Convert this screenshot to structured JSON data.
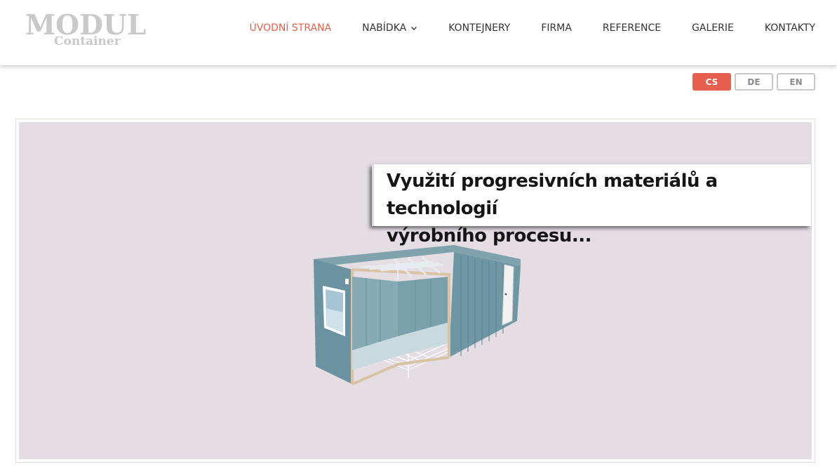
{
  "logo": {
    "line1": "MODUL",
    "line2": "Container"
  },
  "nav": {
    "items": [
      {
        "label": "ÚVODNÍ STRANA",
        "active": true
      },
      {
        "label": "NABÍDKA",
        "dropdown": true
      },
      {
        "label": "KONTEJNERY"
      },
      {
        "label": "FIRMA"
      },
      {
        "label": "REFERENCE"
      },
      {
        "label": "GALERIE"
      },
      {
        "label": "KONTAKTY"
      }
    ]
  },
  "languages": [
    {
      "label": "CS",
      "active": true
    },
    {
      "label": "DE"
    },
    {
      "label": "EN"
    }
  ],
  "slider": {
    "caption": "Využití progresivních materiálů a technologií\nvýrobního procesu...",
    "image": "modular-container-illustration"
  },
  "colors": {
    "accent": "#e6604d",
    "slide_bg": "#e4dee4",
    "container": "#6f97a3"
  }
}
